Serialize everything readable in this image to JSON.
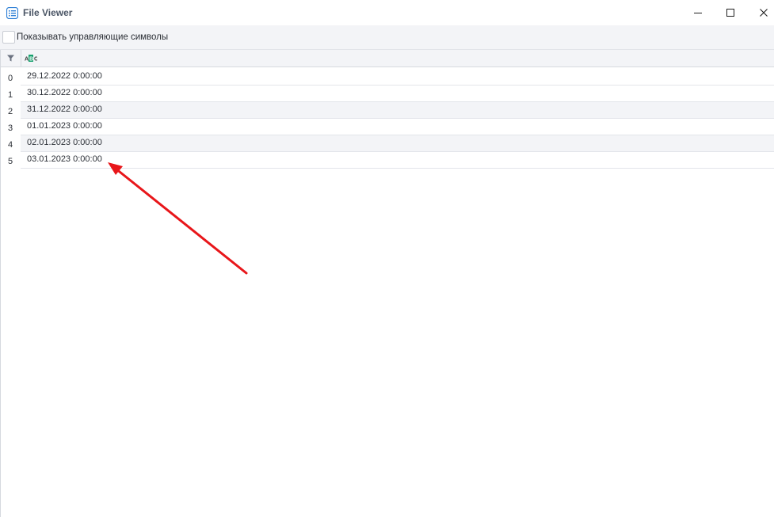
{
  "window": {
    "title": "File Viewer",
    "controls": [
      "minimize-icon",
      "maximize-icon",
      "close-icon"
    ]
  },
  "options": {
    "show_control_chars_label": "Показывать управляющие символы",
    "show_control_chars_checked": false
  },
  "grid": {
    "column_type_icon": "string-type-icon",
    "rows": [
      {
        "index": "0",
        "value": "29.12.2022 0:00:00"
      },
      {
        "index": "1",
        "value": "30.12.2022 0:00:00"
      },
      {
        "index": "2",
        "value": "31.12.2022 0:00:00"
      },
      {
        "index": "3",
        "value": "01.01.2023 0:00:00"
      },
      {
        "index": "4",
        "value": "02.01.2023 0:00:00"
      },
      {
        "index": "5",
        "value": "03.01.2023 0:00:00"
      }
    ]
  },
  "annotation": {
    "arrow_color": "#e8161a"
  },
  "colors": {
    "accent": "#2f80d6",
    "type_badge": "#16a06d"
  }
}
